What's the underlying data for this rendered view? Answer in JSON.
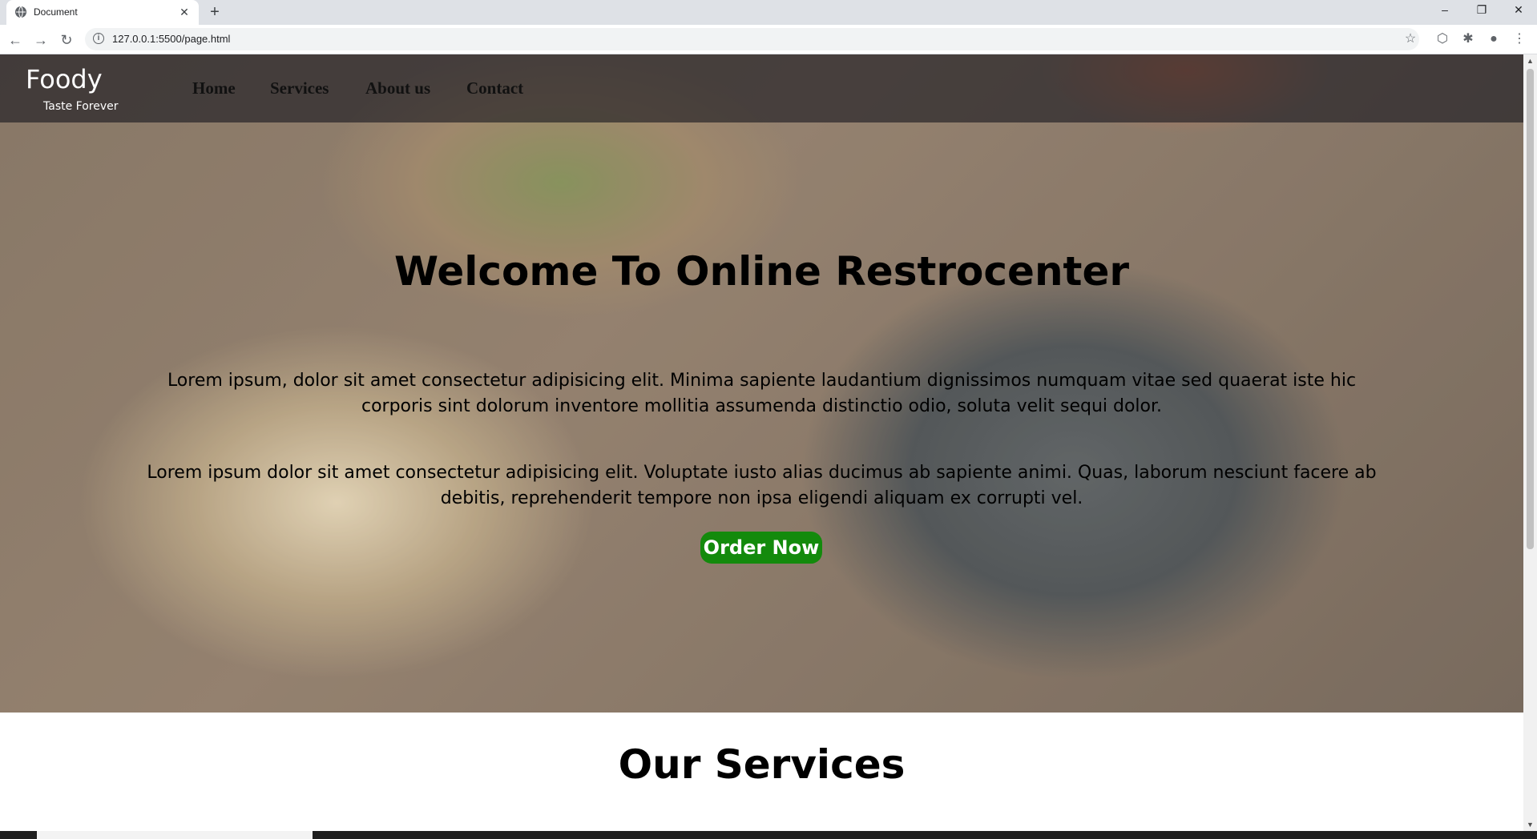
{
  "browser": {
    "tab_title": "Document",
    "url": "127.0.0.1:5500/page.html",
    "tab_close_glyph": "✕",
    "new_tab_glyph": "+",
    "window_controls": [
      "–",
      "❐",
      "✕"
    ]
  },
  "navbar": {
    "logo": "Foody",
    "tagline": "Taste Forever",
    "links": [
      "Home",
      "Services",
      "About us",
      "Contact"
    ]
  },
  "hero": {
    "title": "Welcome To Online Restrocenter",
    "paragraph_1": "Lorem ipsum, dolor sit amet consectetur adipisicing elit. Minima sapiente laudantium dignissimos numquam vitae sed quaerat iste hic corporis sint dolorum inventore mollitia assumenda distinctio odio, soluta velit sequi dolor.",
    "paragraph_2": "Lorem ipsum dolor sit amet consectetur adipisicing elit. Voluptate iusto alias ducimus ab sapiente animi. Quas, laborum nesciunt facere ab debitis, reprehenderit tempore non ipsa eligendi aliquam ex corrupti vel.",
    "button": "Order Now",
    "button_color": "#138a0c"
  },
  "services": {
    "title": "Our Services"
  }
}
